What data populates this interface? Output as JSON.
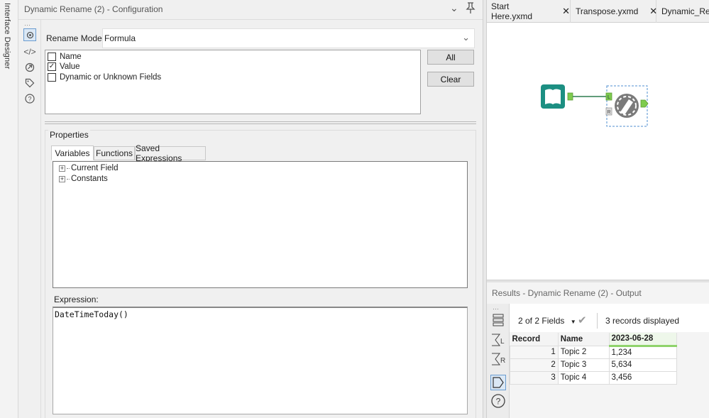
{
  "side_strip": {
    "label": "Interface Designer"
  },
  "config": {
    "title": "Dynamic Rename (2) - Configuration",
    "rename_mode_label": "Rename Mode:",
    "rename_mode_value": "Formula",
    "fields": [
      {
        "label": "Name",
        "checked": false
      },
      {
        "label": "Value",
        "checked": true
      },
      {
        "label": "Dynamic or Unknown Fields",
        "checked": false
      }
    ],
    "buttons": {
      "all": "All",
      "clear": "Clear"
    },
    "properties_label": "Properties",
    "tabs": [
      "Variables",
      "Functions",
      "Saved Expressions"
    ],
    "tree_items": [
      "Current Field",
      "Constants"
    ],
    "expression_label": "Expression:",
    "expression_value": "DateTimeToday()"
  },
  "document_tabs": [
    {
      "label": "Start Here.yxmd"
    },
    {
      "label": "Transpose.yxmd"
    },
    {
      "label": "Dynamic_Ren"
    }
  ],
  "results": {
    "title": "Results - Dynamic Rename (2) - Output",
    "fields_dropdown": "2 of 2 Fields",
    "records_text": "3 records displayed",
    "columns": [
      "Record",
      "Name",
      "2023-06-28"
    ],
    "rows": [
      {
        "record": "1",
        "name": "Topic 2",
        "value": "1,234"
      },
      {
        "record": "2",
        "name": "Topic 3",
        "value": "5,634"
      },
      {
        "record": "3",
        "name": "Topic 4",
        "value": "3,456"
      }
    ]
  },
  "colors": {
    "accent_blue": "#6a9cd0",
    "tool_teal": "#1c8f82",
    "tool_gray": "#7a7a7a",
    "connector_green": "#7ecb4e",
    "column_highlight": "#8fd36b"
  }
}
